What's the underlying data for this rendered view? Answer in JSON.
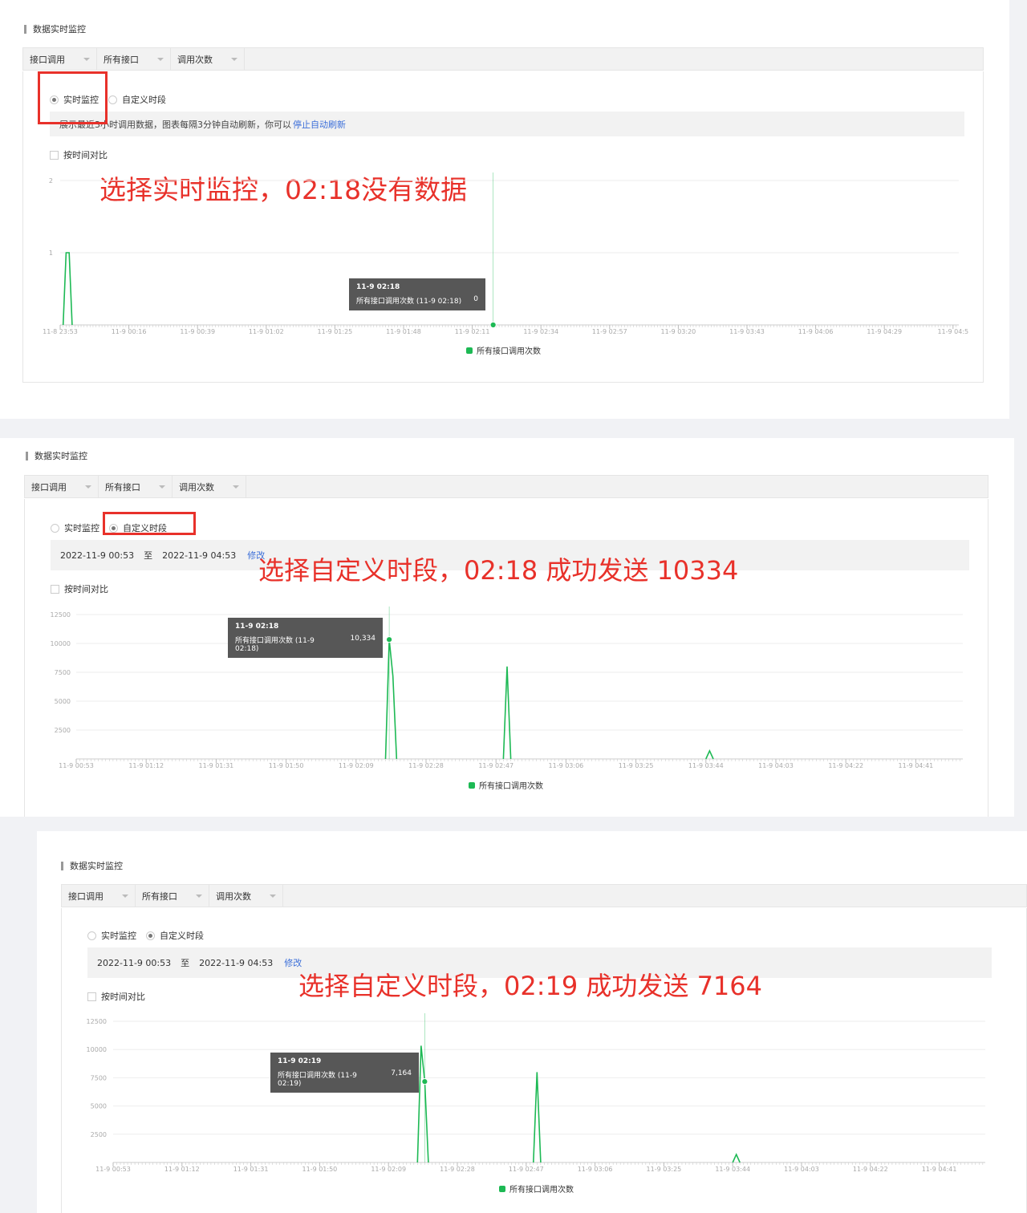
{
  "section_title": "数据实时监控",
  "tabs": [
    "接口调用",
    "所有接口",
    "调用次数"
  ],
  "radio_realtime": "实时监控",
  "radio_custom": "自定义时段",
  "compare_checkbox": "按时间对比",
  "legend_label": "所有接口调用次数",
  "line_color": "#1db954",
  "annotation_color": "#e8312a",
  "panel1": {
    "info_text": "展示最近3小时调用数据，图表每隔3分钟自动刷新，你可以",
    "info_link": "停止自动刷新",
    "annotation": "选择实时监控，02:18没有数据",
    "tooltip": {
      "title": "11-9 02:18",
      "label": "所有接口调用次数 (11-9 02:18)",
      "value": "0"
    }
  },
  "panel2": {
    "date_start": "2022-11-9 00:53",
    "date_sep": "至",
    "date_end": "2022-11-9 04:53",
    "edit_link": "修改",
    "annotation": "选择自定义时段，02:18 成功发送 10334",
    "tooltip": {
      "title": "11-9 02:18",
      "label": "所有接口调用次数 (11-9 02:18)",
      "value": "10,334"
    }
  },
  "panel3": {
    "date_start": "2022-11-9 00:53",
    "date_sep": "至",
    "date_end": "2022-11-9 04:53",
    "edit_link": "修改",
    "annotation": "选择自定义时段，02:19 成功发送 7164",
    "tooltip": {
      "title": "11-9 02:19",
      "label": "所有接口调用次数 (11-9 02:19)",
      "value": "7,164"
    }
  },
  "chart_data": [
    {
      "type": "line",
      "x_tick_labels": [
        "11-8 23:53",
        "11-9 00:16",
        "11-9 00:39",
        "11-9 01:02",
        "11-9 01:25",
        "11-9 01:48",
        "11-9 02:11",
        "11-9 02:34",
        "11-9 02:57",
        "11-9 03:20",
        "11-9 03:43",
        "11-9 04:06",
        "11-9 04:29",
        "11-9 04:5"
      ],
      "y_tick_labels": [
        "1",
        "2"
      ],
      "ylim": [
        0,
        2
      ],
      "series": [
        {
          "name": "所有接口调用次数",
          "points": [
            [
              "11-8 23:54",
              0
            ],
            [
              "11-8 23:55",
              1
            ],
            [
              "11-8 23:56",
              1
            ],
            [
              "11-8 23:57",
              0
            ],
            [
              "11-9 02:18",
              0
            ]
          ]
        }
      ],
      "hover": {
        "x": "11-9 02:18",
        "y": 0
      }
    },
    {
      "type": "line",
      "x_tick_labels": [
        "11-9 00:53",
        "11-9 01:12",
        "11-9 01:31",
        "11-9 01:50",
        "11-9 02:09",
        "11-9 02:28",
        "11-9 02:47",
        "11-9 03:06",
        "11-9 03:25",
        "11-9 03:44",
        "11-9 04:03",
        "11-9 04:22",
        "11-9 04:41"
      ],
      "y_tick_labels": [
        "2500",
        "5000",
        "7500",
        "10000",
        "12500"
      ],
      "ylim": [
        0,
        12500
      ],
      "series": [
        {
          "name": "所有接口调用次数",
          "points": [
            [
              "11-9 02:17",
              0
            ],
            [
              "11-9 02:18",
              10334
            ],
            [
              "11-9 02:19",
              7164
            ],
            [
              "11-9 02:20",
              0
            ],
            [
              "11-9 02:49",
              0
            ],
            [
              "11-9 02:50",
              8000
            ],
            [
              "11-9 02:51",
              0
            ],
            [
              "11-9 03:44",
              0
            ],
            [
              "11-9 03:45",
              700
            ],
            [
              "11-9 03:46",
              0
            ]
          ]
        }
      ],
      "hover": {
        "x": "11-9 02:18",
        "y": 10334
      }
    },
    {
      "type": "line",
      "x_tick_labels": [
        "11-9 00:53",
        "11-9 01:12",
        "11-9 01:31",
        "11-9 01:50",
        "11-9 02:09",
        "11-9 02:28",
        "11-9 02:47",
        "11-9 03:06",
        "11-9 03:25",
        "11-9 03:44",
        "11-9 04:03",
        "11-9 04:22",
        "11-9 04:41"
      ],
      "y_tick_labels": [
        "2500",
        "5000",
        "7500",
        "10000",
        "12500"
      ],
      "ylim": [
        0,
        12500
      ],
      "series": [
        {
          "name": "所有接口调用次数",
          "points": [
            [
              "11-9 02:17",
              0
            ],
            [
              "11-9 02:18",
              10334
            ],
            [
              "11-9 02:19",
              7164
            ],
            [
              "11-9 02:20",
              0
            ],
            [
              "11-9 02:49",
              0
            ],
            [
              "11-9 02:50",
              8000
            ],
            [
              "11-9 02:51",
              0
            ],
            [
              "11-9 03:44",
              0
            ],
            [
              "11-9 03:45",
              700
            ],
            [
              "11-9 03:46",
              0
            ]
          ]
        }
      ],
      "hover": {
        "x": "11-9 02:19",
        "y": 7164
      }
    }
  ]
}
